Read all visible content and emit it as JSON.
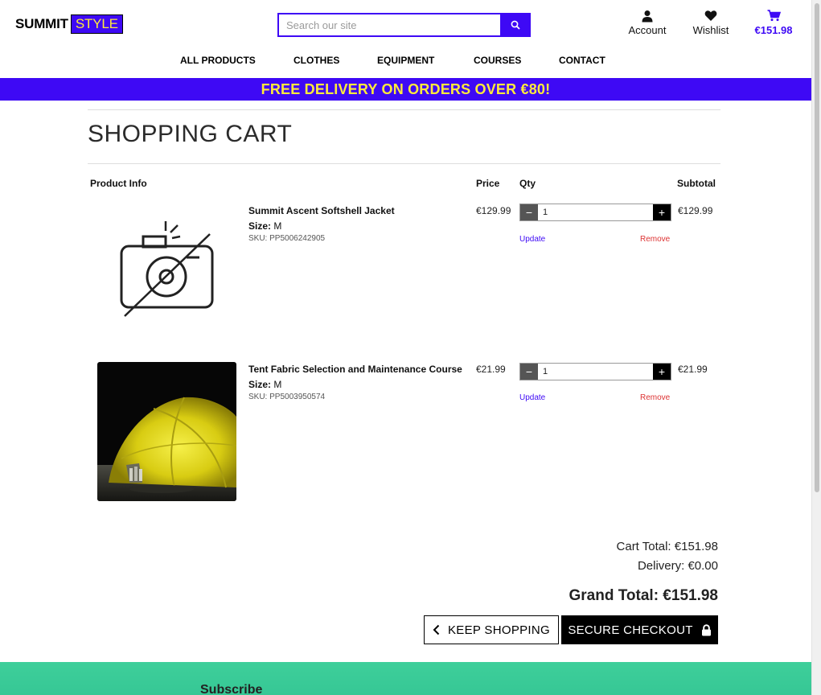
{
  "header": {
    "logo_part1": "SUMMIT",
    "logo_part2": "STYLE",
    "search_placeholder": "Search our site",
    "account_label": "Account",
    "wishlist_label": "Wishlist",
    "cart_total": "€151.98"
  },
  "nav": {
    "items": [
      "ALL PRODUCTS",
      "CLOTHES",
      "EQUIPMENT",
      "COURSES",
      "CONTACT"
    ]
  },
  "banner": {
    "text": "FREE DELIVERY ON ORDERS OVER €80!"
  },
  "cart": {
    "title": "SHOPPING CART",
    "columns": {
      "product_info": "Product Info",
      "price": "Price",
      "qty": "Qty",
      "subtotal": "Subtotal"
    },
    "size_label": "Size:",
    "update_label": "Update",
    "remove_label": "Remove",
    "items": [
      {
        "name": "Summit Ascent Softshell Jacket",
        "size": "M",
        "sku": "SKU: PP5006242905",
        "price": "€129.99",
        "qty": "1",
        "subtotal": "€129.99",
        "image": "no-image-placeholder"
      },
      {
        "name": "Tent Fabric Selection and Maintenance Course",
        "size": "M",
        "sku": "SKU: PP5003950574",
        "price": "€21.99",
        "qty": "1",
        "subtotal": "€21.99",
        "image": "yellow-tent-at-night"
      }
    ],
    "cart_total_label": "Cart Total: €151.98",
    "delivery_label": "Delivery: €0.00",
    "grand_total_label": "Grand Total: €151.98",
    "keep_shopping": "KEEP SHOPPING",
    "secure_checkout": "SECURE CHECKOUT"
  },
  "footer": {
    "subscribe_heading": "Subscribe"
  },
  "colors": {
    "brand": "#3e09f5",
    "accent_yellow": "#ffeb3b",
    "footer_green": "#3ecf9a",
    "remove_red": "#dd3333"
  }
}
